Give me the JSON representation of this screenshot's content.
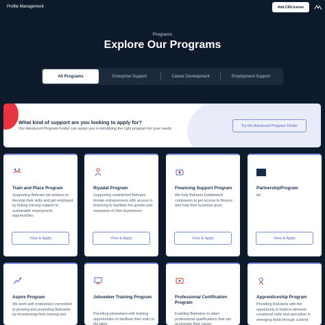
{
  "header": {
    "profile_label": "Profile Management",
    "add_button_label": "Add CR/License",
    "language_icon": "language-icon"
  },
  "hero": {
    "kicker": "Programs",
    "title": "Explore Our Programs"
  },
  "tabs": [
    {
      "label": "All Programs",
      "active": true
    },
    {
      "label": "Enterprise Support",
      "active": false
    },
    {
      "label": "Career Development",
      "active": false
    },
    {
      "label": "Employment Support",
      "active": false
    }
  ],
  "finder": {
    "title": "What kind of support are you looking to apply for?",
    "subtitle": "Our Advanced Program Finder can assist you in identifying the right program for your needs",
    "button_label": "Try the Advanced Program Finder"
  },
  "programs_row1": [
    {
      "title": "Train and Place Program",
      "description": "Supporting Bahraini job seekers to develop their skills and get employed by linking training support to sustainable employment opportunities",
      "button_label": "View & Apply",
      "icon": "handshake-icon"
    },
    {
      "title": "Riyadat Program",
      "description": "Supporting established Bahraini female entrepreneurs with access to financing to facilitate the growth and expansion of their businesses",
      "button_label": "View & Apply",
      "icon": "woman-entrepreneur-icon"
    },
    {
      "title": "Financing Support Program",
      "description": "We help Bahraini Established companies to get access to finance and help their business grow",
      "button_label": "View & Apply",
      "icon": "finance-icon"
    },
    {
      "title": "PartnershipProgram",
      "description": "tet",
      "button_label": "View & Apply",
      "icon": "partnership-logo-icon"
    }
  ],
  "programs_row2": [
    {
      "title": "Aspire Program",
      "description": "We work with enterprises committed to growing and promoting Bahrainis by incentivising their training and",
      "icon": "growth-icon"
    },
    {
      "title": "Jobseeker Training Program",
      "description": "Providing jobseekers with training opportunities to facilitate their entry to the labor",
      "icon": "training-icon"
    },
    {
      "title": "Professional Certification Program",
      "description": "Enabling Bahrainis to attain professional qualifications that can accelerate their career",
      "icon": "certificate-icon"
    },
    {
      "title": "Apprenticeship Program",
      "description": "Providing Bahrainis with the opportunity to build in-demand vocational skills and specialize in emerging fields through a blend",
      "icon": "apprentice-icon"
    }
  ],
  "colors": {
    "page_bg": "#0d1a2b",
    "accent_red": "#e8343f",
    "accent_blue": "#5064c8",
    "card_border": "#7b8ce0"
  }
}
